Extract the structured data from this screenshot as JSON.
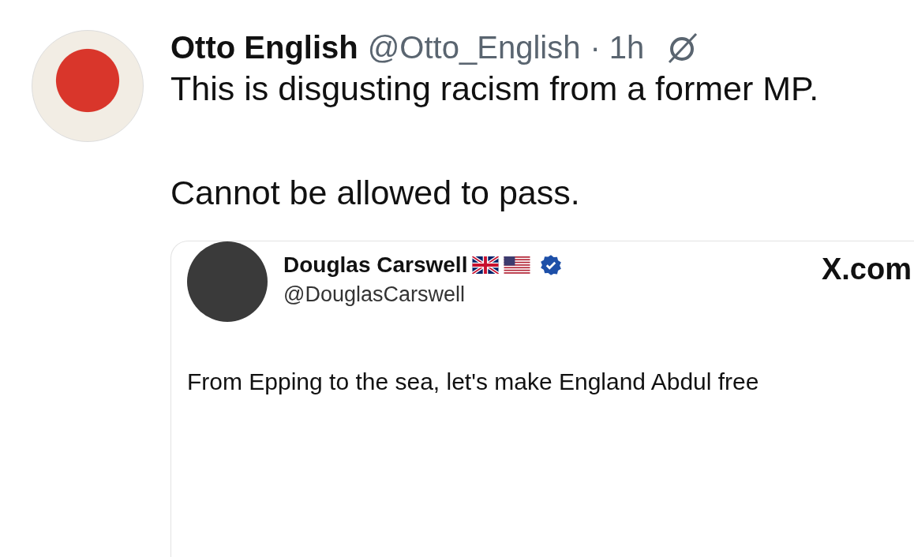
{
  "post": {
    "author": "Otto English",
    "handle": "@Otto_English",
    "time": "· 1h",
    "text": "This is disgusting racism from a former MP.\n\nCannot be allowed to pass."
  },
  "embed": {
    "author": "Douglas Carswell",
    "verified": true,
    "handle": "@DouglasCarswell",
    "site": "X.com",
    "text": "From Epping to the sea, let's make England Abdul free"
  }
}
